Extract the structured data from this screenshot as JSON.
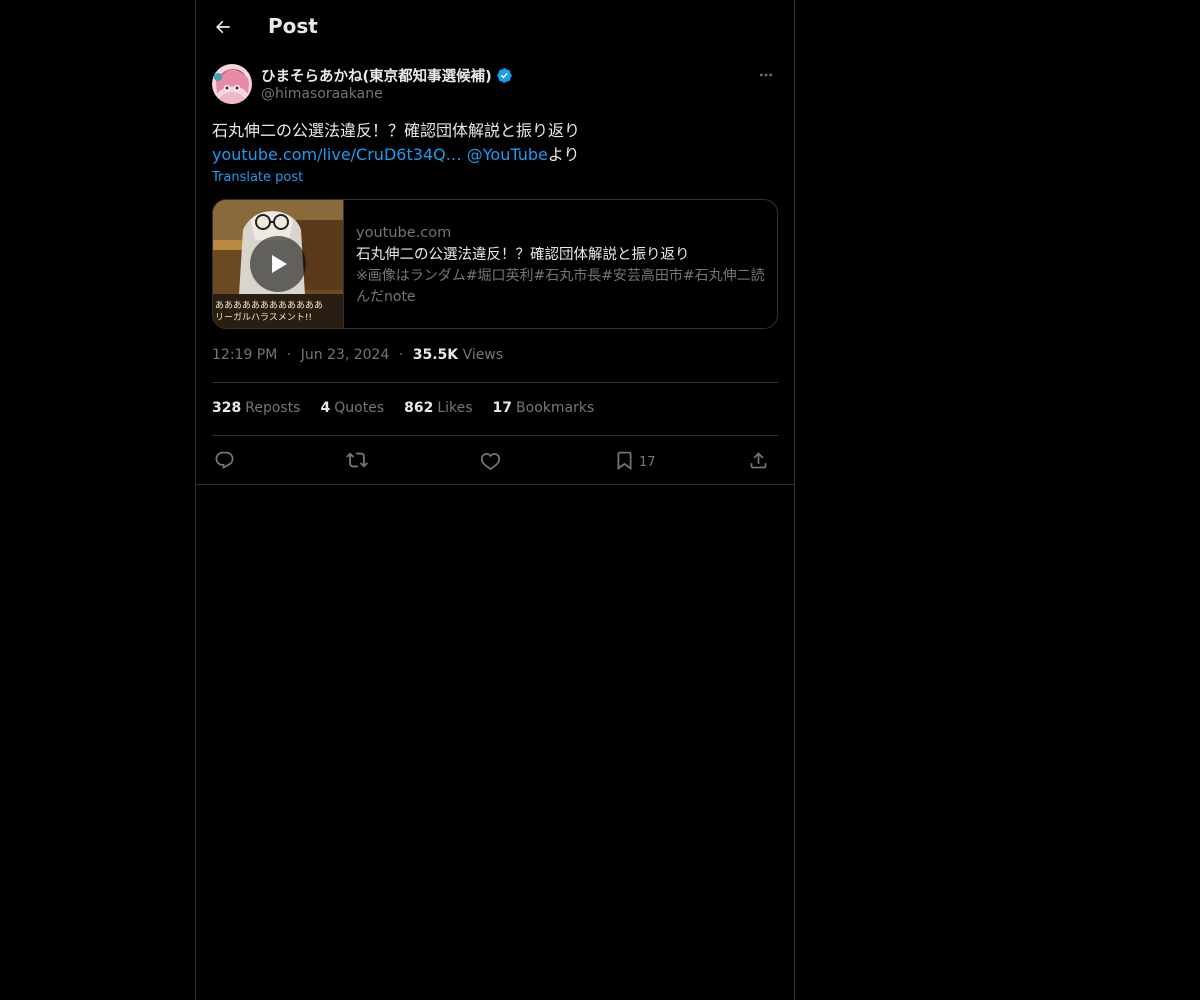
{
  "header": {
    "title": "Post",
    "back_icon": "arrow-left-icon"
  },
  "author": {
    "display_name": "ひまそらあかね(東京都知事選候補)",
    "handle": "@himasoraakane",
    "verified": true,
    "verified_color": "#1d9bf0"
  },
  "post": {
    "text_line1": "石丸伸二の公選法違反！？確認団体解説と振り返り",
    "link_text": "youtube.com/live/CruD6t34Q…",
    "mention": "@YouTube",
    "suffix": "より",
    "translate_label": "Translate post"
  },
  "card": {
    "domain": "youtube.com",
    "title": "石丸伸二の公選法違反！？確認団体解説と振り返り",
    "description": "※画像はランダム#堀口英利#石丸市長#安芸高田市#石丸伸二読んだnote",
    "thumb_caption_1": "ああああああああああああ",
    "thumb_caption_2": "リーガルハラスメント!!"
  },
  "meta": {
    "time": "12:19 PM",
    "date": "Jun 23, 2024",
    "separator": "·",
    "views_count": "35.5K",
    "views_label": "Views"
  },
  "stats": {
    "reposts_count": "328",
    "reposts_label": "Reposts",
    "quotes_count": "4",
    "quotes_label": "Quotes",
    "likes_count": "862",
    "likes_label": "Likes",
    "bookmarks_count": "17",
    "bookmarks_label": "Bookmarks"
  },
  "actions": {
    "bookmark_count": "17",
    "icons": [
      "reply-icon",
      "repost-icon",
      "like-icon",
      "bookmark-icon",
      "share-icon"
    ]
  },
  "colors": {
    "background": "#000000",
    "text": "#e7e9ea",
    "muted": "#71767b",
    "accent": "#1d9bf0",
    "border": "#2f3336"
  }
}
